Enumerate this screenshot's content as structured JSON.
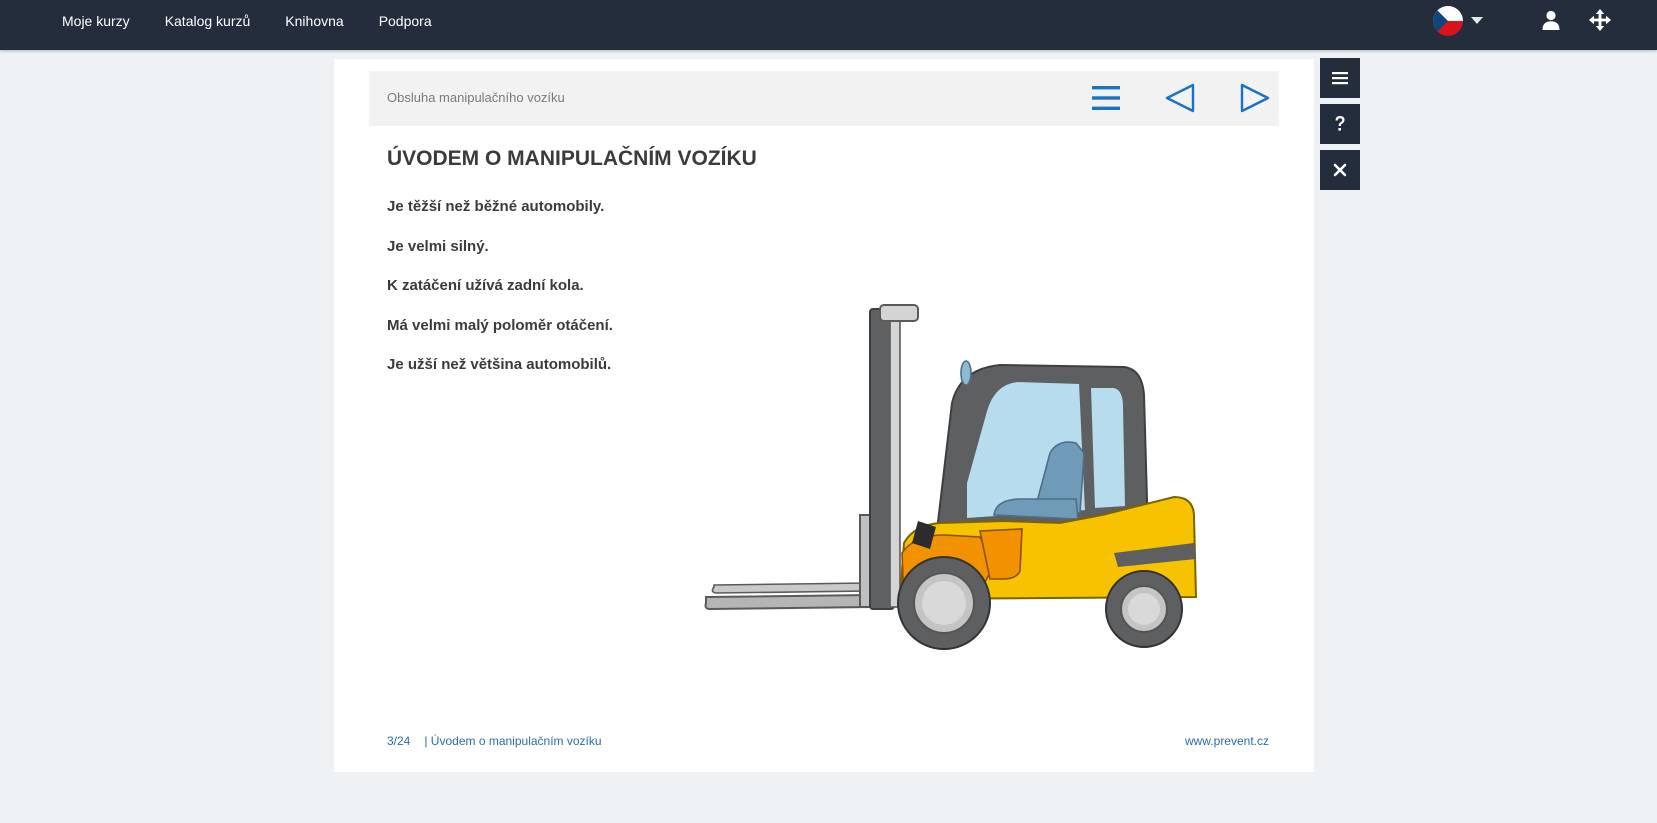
{
  "nav": {
    "items": [
      "Moje kurzy",
      "Katalog kurzů",
      "Knihovna",
      "Podpora"
    ]
  },
  "header": {
    "language_icon": "czech-flag-icon",
    "icons": [
      "caret-down-icon",
      "user-icon",
      "move-icon"
    ]
  },
  "toolbar": {
    "course_title": "Obsluha manipulačního vozíku",
    "icons": [
      "menu-icon",
      "prev-triangle-icon",
      "next-triangle-icon"
    ]
  },
  "slide": {
    "heading": "ÚVODEM O MANIPULAČNÍM VOZÍKU",
    "facts": [
      "Je těžší než běžné automobily.",
      "Je velmi silný.",
      "K zatáčení užívá zadní kola.",
      "Má velmi malý poloměr otáčení.",
      "Je užší než většina automobilů."
    ],
    "image": "forklift-illustration"
  },
  "footer": {
    "page": "3/24",
    "section": "| Úvodem o manipulačním vozíku",
    "site": "www.prevent.cz"
  },
  "side_buttons": [
    "menu-icon",
    "question-icon",
    "close-icon"
  ],
  "colors": {
    "topbar": "#232d3b",
    "accent": "#1a73c0",
    "background": "#eef2f5",
    "forklift_yellow": "#f7c300",
    "forklift_orange": "#f39200"
  }
}
